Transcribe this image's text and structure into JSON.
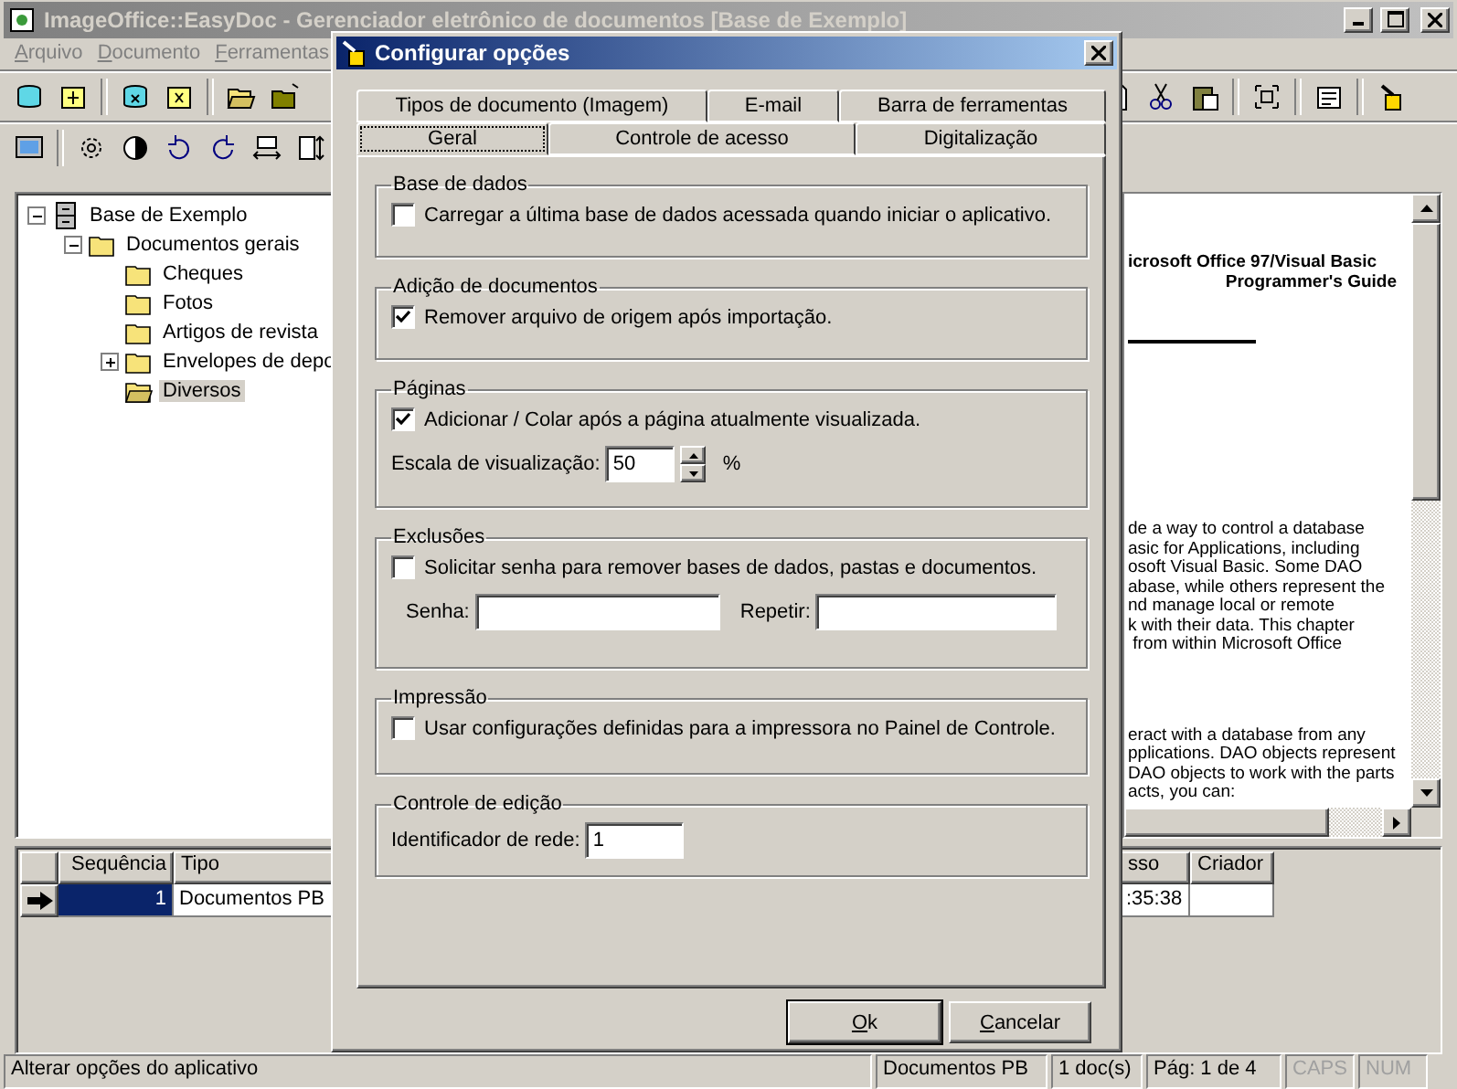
{
  "window": {
    "title": "ImageOffice::EasyDoc - Gerenciador eletrônico de documentos [Base de Exemplo]"
  },
  "menu": [
    {
      "label": "Arquivo"
    },
    {
      "label": "Documento"
    },
    {
      "label": "Ferramentas"
    }
  ],
  "tree": [
    {
      "label": "Base de Exemplo",
      "kind": "cabinet",
      "expanded": true,
      "selected": false,
      "children": [
        {
          "label": "Documentos gerais",
          "kind": "folder",
          "expanded": true,
          "selected": false,
          "children": [
            {
              "label": "Cheques",
              "kind": "folder",
              "selected": false
            },
            {
              "label": "Fotos",
              "kind": "folder",
              "selected": false
            },
            {
              "label": "Artigos de revista",
              "kind": "folder",
              "selected": false
            },
            {
              "label": "Envelopes de depo",
              "kind": "folder",
              "expanded": false,
              "selected": false
            },
            {
              "label": "Diversos",
              "kind": "folder",
              "selected": true
            }
          ]
        }
      ]
    }
  ],
  "document_preview": {
    "heading": [
      "icrosoft Office 97/Visual Basic",
      "Programmer's Guide"
    ],
    "paragraphs": [
      [
        "de a way to control a database",
        "asic for Applications, including",
        "osoft Visual Basic. Some DAO",
        "abase, while others represent the",
        "nd manage local or remote",
        "k with their data. This chapter",
        " from within Microsoft Office"
      ],
      [
        "eract with a database from any",
        "pplications. DAO objects represent",
        "DAO objects to work with the parts",
        "acts, you can:"
      ]
    ]
  },
  "grid": {
    "columns": [
      "Sequência",
      "Tipo"
    ],
    "rows": [
      {
        "selected": true,
        "cells": [
          "1",
          "Documentos PB"
        ]
      }
    ]
  },
  "grid_right": {
    "columns": [
      "sso",
      "Criador"
    ],
    "rows": [
      {
        "cells": [
          ":35:38"
        ]
      }
    ]
  },
  "status_bar": [
    {
      "text": "Alterar opções do aplicativo",
      "disabled": false
    },
    {
      "text": "Documentos PB",
      "disabled": false
    },
    {
      "text": "1 doc(s)",
      "disabled": false
    },
    {
      "text": "Pág: 1 de 4",
      "disabled": false
    },
    {
      "text": "CAPS",
      "disabled": true
    },
    {
      "text": "NUM",
      "disabled": true
    }
  ],
  "dialog": {
    "title": "Configurar opções",
    "tab_rows": [
      [
        {
          "label": "Tipos de documento (Imagem)",
          "selected": false
        },
        {
          "label": "E-mail",
          "selected": false
        },
        {
          "label": "Barra de ferramentas",
          "selected": false
        }
      ],
      [
        {
          "label": "Geral",
          "selected": true
        },
        {
          "label": "Controle de acesso",
          "selected": false
        },
        {
          "label": "Digitalização",
          "selected": false
        }
      ]
    ],
    "groups": [
      {
        "title": "Base de dados",
        "items": [
          {
            "kind": "checkbox",
            "label": "Carregar a última base de dados acessada quando iniciar o aplicativo.",
            "checked": false
          }
        ]
      },
      {
        "title": "Adição de documentos",
        "items": [
          {
            "kind": "checkbox",
            "label": "Remover arquivo de origem após importação.",
            "checked": true
          }
        ]
      },
      {
        "title": "Páginas",
        "items": [
          {
            "kind": "checkbox",
            "label": "Adicionar / Colar após a página atualmente visualizada.",
            "checked": true
          },
          {
            "kind": "spinner",
            "label": "Escala de visualização:",
            "value": "50",
            "unit": "%"
          }
        ]
      },
      {
        "title": "Exclusões",
        "items": [
          {
            "kind": "checkbox",
            "label": "Solicitar senha para remover bases de dados, pastas e documentos.",
            "checked": false
          },
          {
            "kind": "field_pair",
            "fields": [
              {
                "label": "Senha:"
              },
              {
                "label": "Repetir:"
              }
            ]
          }
        ]
      },
      {
        "title": "Impressão",
        "items": [
          {
            "kind": "checkbox",
            "label": "Usar configurações definidas para a impressora no Painel de Controle.",
            "checked": false
          }
        ]
      },
      {
        "title": "Controle de edição",
        "items": [
          {
            "kind": "textfield",
            "label": "Identificador de rede:",
            "value": "1"
          }
        ]
      }
    ],
    "buttons": [
      {
        "label": "Ok",
        "default": true
      },
      {
        "label": "Cancelar",
        "default": false
      }
    ]
  }
}
